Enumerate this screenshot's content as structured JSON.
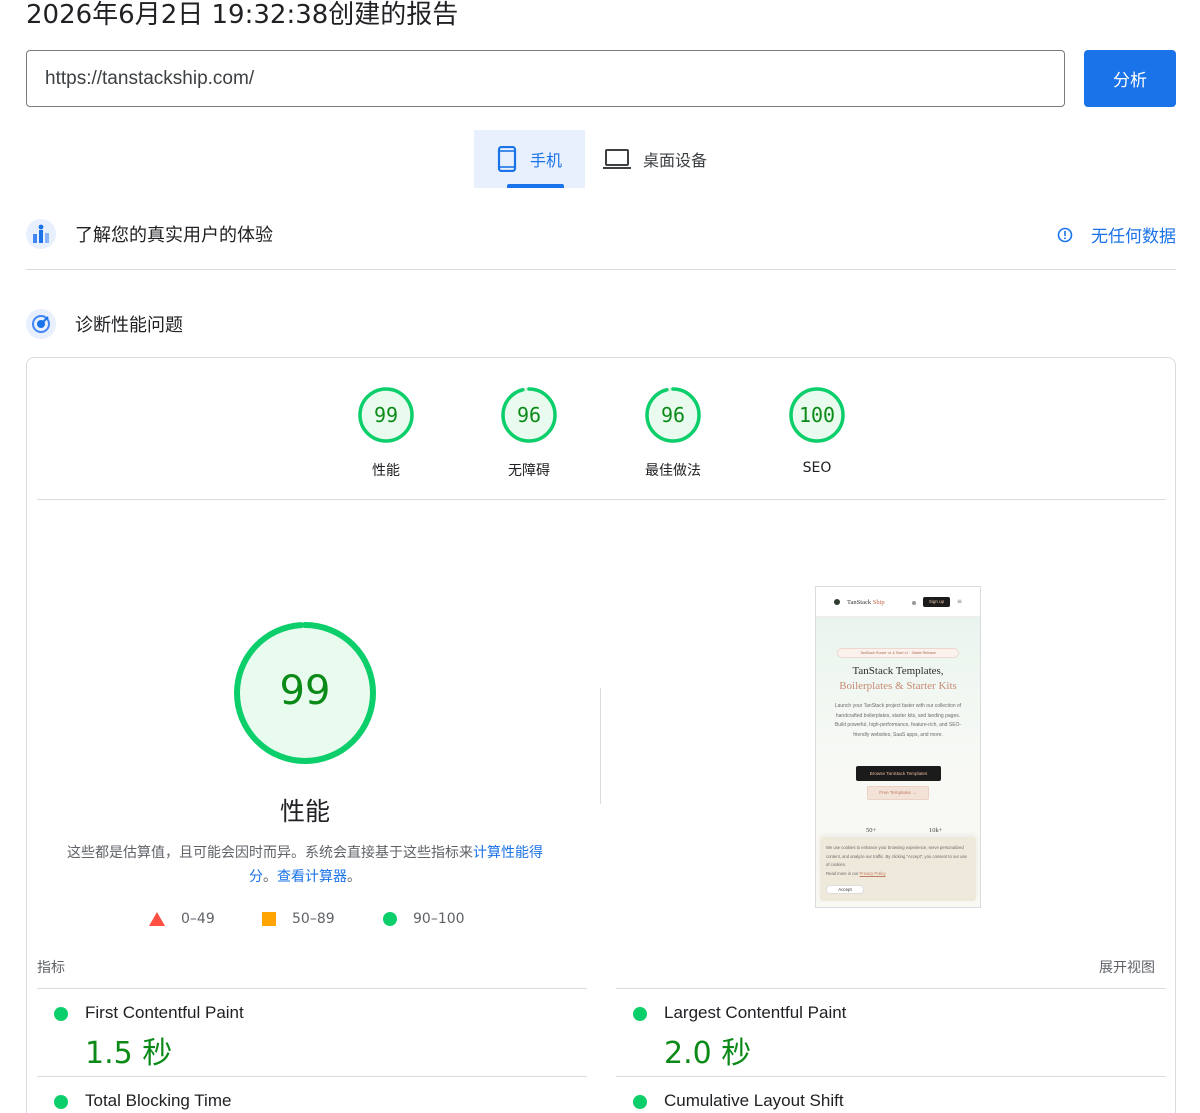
{
  "report": {
    "title": "2026年6月2日 19:32:38创建的报告"
  },
  "search": {
    "url": "https://tanstackship.com/",
    "analyze_label": "分析"
  },
  "tabs": {
    "mobile": "手机",
    "desktop": "桌面设备"
  },
  "field_data": {
    "title": "了解您的真实用户的体验",
    "no_data": "无任何数据"
  },
  "diagnose": {
    "title": "诊断性能问题"
  },
  "categories": [
    {
      "label": "性能",
      "score": "99",
      "value": 99
    },
    {
      "label": "无障碍",
      "score": "96",
      "value": 96
    },
    {
      "label": "最佳做法",
      "score": "96",
      "value": 96
    },
    {
      "label": "SEO",
      "score": "100",
      "value": 100
    }
  ],
  "performance": {
    "score": "99",
    "value": 99,
    "label": "性能",
    "note_text": "这些都是估算值，且可能会因时而异。系统会直接基于这些指标来",
    "note_link1": "计算性能得分",
    "note_sep": "。",
    "note_link2": "查看计算器",
    "note_end": "。"
  },
  "legend": {
    "poor": "0–49",
    "average": "50–89",
    "good": "90–100"
  },
  "preview": {
    "brand": "TanStack",
    "brand_accent": "Ship",
    "signup": "Sign up",
    "badge": "TanStack Router v1 & Start v1 · Stable Release",
    "headline1": "TanStack Templates,",
    "headline2": "Boilerplates & Starter Kits",
    "body": "Launch your TanStack project faster with our collection of handcrafted boilerplates, starter kits, and landing pages. Build powerful, high-performance, feature-rich, and SEO-friendly websites, SaaS apps, and more.",
    "cta_primary": "Browse TanStack Templates",
    "cta_secondary": "Free Templates →",
    "stat1": "50+",
    "stat2": "10k+",
    "cookie_text": "We use cookies to enhance your browsing experience, serve personalized content, and analyze our traffic. By clicking \"Accept\", you consent to our use of cookies.",
    "cookie_more": "Read more in our",
    "cookie_link": "Privacy Policy",
    "cookie_accept": "Accept"
  },
  "metrics": {
    "section_label": "指标",
    "expand_label": "展开视图",
    "items": [
      {
        "name": "First Contentful Paint",
        "value": "1.5 秒"
      },
      {
        "name": "Largest Contentful Paint",
        "value": "2.0 秒"
      },
      {
        "name": "Total Blocking Time",
        "value": ""
      },
      {
        "name": "Cumulative Layout Shift",
        "value": ""
      }
    ]
  },
  "colors": {
    "accent": "#1a73e8",
    "good": "#0cce6b",
    "good_text": "#008800",
    "average": "#ffa400",
    "poor": "#ff4e42"
  },
  "icons": {
    "mobile_tab": "smartphone-icon",
    "desktop_tab": "laptop-icon",
    "field": "users-chart-icon",
    "lab": "lighthouse-icon",
    "info": "info-icon"
  }
}
